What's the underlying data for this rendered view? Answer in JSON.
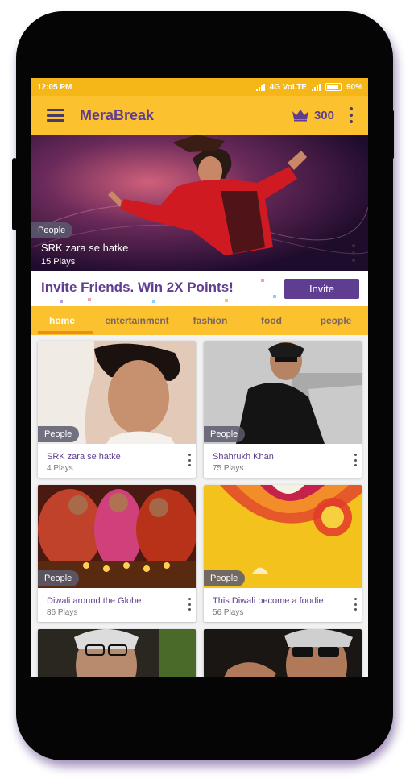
{
  "status_bar": {
    "time": "12:05 PM",
    "network": "4G VoLTE",
    "battery": "90%"
  },
  "app_bar": {
    "title": "MeraBreak",
    "points": "300",
    "icons": [
      "menu-icon",
      "crown-icon",
      "more-vert-icon"
    ]
  },
  "hero": {
    "tag": "People",
    "title": "SRK zara se hatke",
    "plays": "15 Plays"
  },
  "banner": {
    "headline": "Invite Friends. Win 2X Points!",
    "button": "Invite"
  },
  "tabs": [
    {
      "label": "home",
      "active": true
    },
    {
      "label": "entertainment",
      "active": false
    },
    {
      "label": "fashion",
      "active": false
    },
    {
      "label": "food",
      "active": false
    },
    {
      "label": "people",
      "active": false
    }
  ],
  "cards": [
    {
      "tag": "People",
      "title": "SRK zara se hatke",
      "plays": "4 Plays"
    },
    {
      "tag": "People",
      "title": "Shahrukh Khan",
      "plays": "75 Plays"
    },
    {
      "tag": "People",
      "title": "Diwali around the Globe",
      "plays": "86 Plays"
    },
    {
      "tag": "People",
      "title": "This Diwali become a foodie",
      "plays": "56 Plays"
    }
  ],
  "colors": {
    "accent_yellow": "#fbc12f",
    "status_yellow": "#f5b617",
    "brand_purple": "#5f3d91",
    "tab_indicator": "#f08a1a"
  }
}
